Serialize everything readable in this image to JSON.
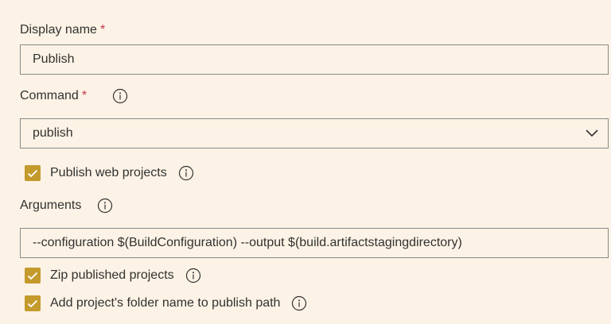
{
  "display_name": {
    "label": "Display name",
    "required_mark": "*",
    "value": "Publish"
  },
  "command": {
    "label": "Command",
    "required_mark": "*",
    "info_icon": "info-icon",
    "selected": "publish",
    "dropdown_icon": "chevron-down-icon"
  },
  "publish_web_projects": {
    "label": "Publish web projects",
    "checked": true,
    "info_icon": "info-icon"
  },
  "arguments": {
    "label": "Arguments",
    "info_icon": "info-icon",
    "value": "--configuration $(BuildConfiguration) --output $(build.artifactstagingdirectory)"
  },
  "zip_published_projects": {
    "label": "Zip published projects",
    "checked": true,
    "info_icon": "info-icon"
  },
  "add_folder_name": {
    "label": "Add project's folder name to publish path",
    "checked": true,
    "info_icon": "info-icon"
  },
  "colors": {
    "background": "#fcf3e6",
    "checkbox_fill": "#c49a2c",
    "required": "#c4314b",
    "border": "#8a8886"
  }
}
